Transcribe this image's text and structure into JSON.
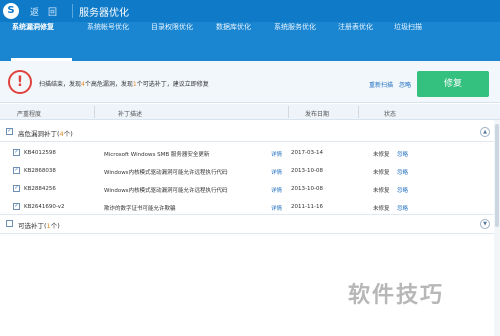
{
  "titlebar": {
    "logo_glyph": "S",
    "back_label": "返　回",
    "title": "服务器优化"
  },
  "tabs": [
    {
      "label": "系统漏洞修复",
      "active": true
    },
    {
      "label": "系统帐号优化",
      "active": false
    },
    {
      "label": "目录权限优化",
      "active": false
    },
    {
      "label": "数据库优化",
      "active": false
    },
    {
      "label": "系统服务优化",
      "active": false
    },
    {
      "label": "注册表优化",
      "active": false
    },
    {
      "label": "垃圾扫描",
      "active": false
    }
  ],
  "alert": {
    "icon_glyph": "!",
    "text_prefix": "扫描结束，发现",
    "high_count": "4",
    "text_mid1": "个高危漏洞，发现",
    "optional_count": "1",
    "text_suffix": "个可选补丁，建议立即修复",
    "rescan_label": "重新扫描",
    "ignore_all_label": "忽略",
    "repair_label": "修复"
  },
  "table": {
    "headers": {
      "severity": "严重程度",
      "desc": "补丁描述",
      "date": "发布日期",
      "status": "状态"
    }
  },
  "groups": {
    "high": {
      "label": "高危漏洞补丁",
      "count": "4",
      "check": "✓",
      "collapse": "▲"
    },
    "optional": {
      "label": "可选补丁",
      "count": "1",
      "collapse": "▼"
    }
  },
  "patches": [
    {
      "kb": "KB4012598",
      "desc": "Microsoft Windows SMB 服务器安全更新",
      "detail": "详情",
      "date": "2017-03-14",
      "status": "未修复",
      "ignore": "忽略"
    },
    {
      "kb": "KB2868038",
      "desc": "Windows内核模式驱动漏洞可能允许远程执行代码",
      "detail": "详情",
      "date": "2013-10-08",
      "status": "未修复",
      "ignore": "忽略"
    },
    {
      "kb": "KB2884256",
      "desc": "Windows内核模式驱动漏洞可能允许远程执行代码",
      "detail": "详情",
      "date": "2013-10-08",
      "status": "未修复",
      "ignore": "忽略"
    },
    {
      "kb": "KB2641690-v2",
      "desc": "欺诈的数字证书可能允许欺骗",
      "detail": "详情",
      "date": "2011-11-16",
      "status": "未修复",
      "ignore": "忽略"
    }
  ],
  "checkmark": "✓",
  "watermark": "软件技巧"
}
